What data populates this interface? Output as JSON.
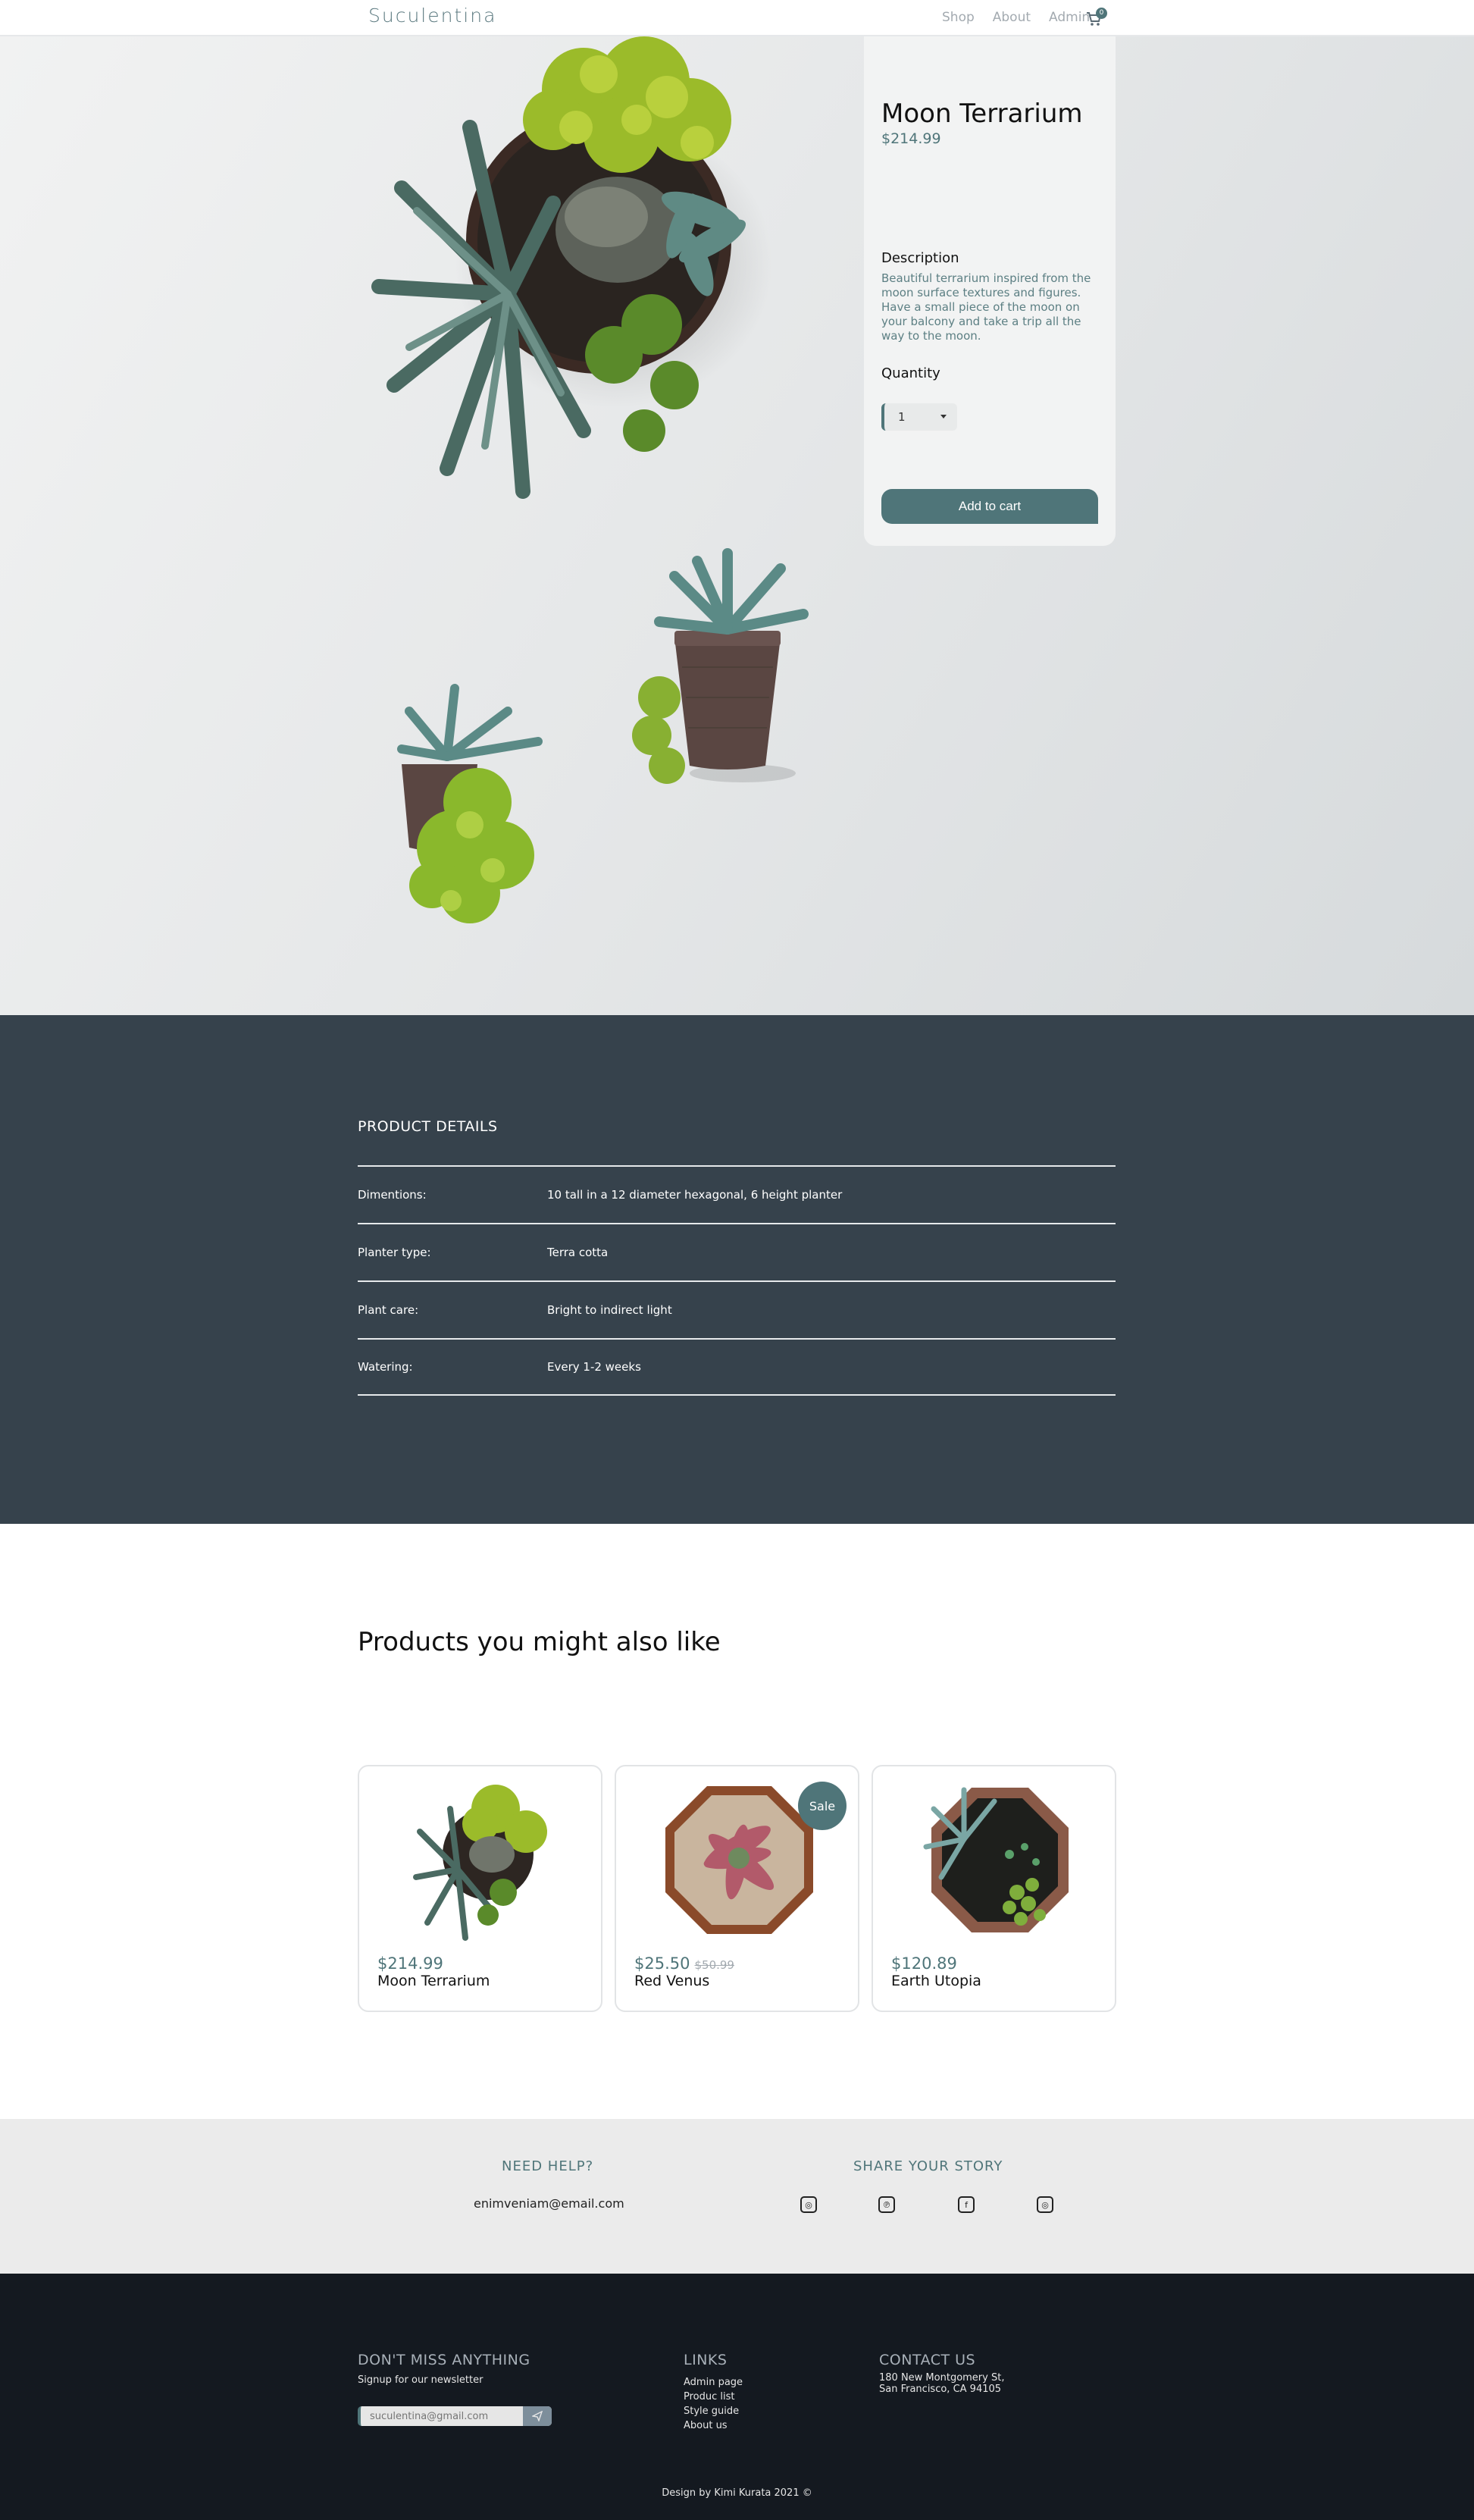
{
  "nav": {
    "logo": "Suculentina",
    "links": [
      "Shop",
      "About",
      "Admin"
    ],
    "cart_count": "0",
    "cart_icon": "cart-icon"
  },
  "product": {
    "title": "Moon Terrarium",
    "price": "$214.99",
    "description_heading": "Description",
    "description": "Beautiful terrarium inspired from the moon surface textures and figures. Have a small piece of the moon on your balcony and take a trip all the way to the moon.",
    "quantity_heading": "Quantity",
    "quantity_value": "1",
    "add_to_cart": "Add to cart"
  },
  "details": {
    "title": "PRODUCT DETAILS",
    "rows": [
      {
        "label": "Dimentions:",
        "value": "10 tall in a 12 diameter hexagonal, 6 height planter"
      },
      {
        "label": "Planter type:",
        "value": "Terra cotta"
      },
      {
        "label": "Plant care:",
        "value": "Bright to indirect light"
      },
      {
        "label": "Watering:",
        "value": "Every 1-2 weeks"
      }
    ]
  },
  "related": {
    "title": "Products you might also like",
    "cards": [
      {
        "price": "$214.99",
        "old_price": "",
        "name": "Moon Terrarium",
        "sale": ""
      },
      {
        "price": "$25.50",
        "old_price": "$50.99",
        "name": "Red Venus",
        "sale": "Sale"
      },
      {
        "price": "$120.89",
        "old_price": "",
        "name": "Earth Utopia",
        "sale": ""
      }
    ]
  },
  "help": {
    "need_help": "NEED HELP?",
    "email": "enimveniam@email.com",
    "share": "SHARE YOUR STORY",
    "social_icons": [
      "instagram-icon",
      "pinterest-icon",
      "facebook-icon",
      "instagram-icon"
    ]
  },
  "footer": {
    "newsletter_heading": "DON'T MISS ANYTHING",
    "newsletter_sub": "Signup for our newsletter",
    "newsletter_placeholder": "suculentina@gmail.com",
    "links_heading": "LINKS",
    "links": [
      "Admin page",
      "Produc list",
      "Style guide",
      "About us"
    ],
    "contact_heading": "CONTACT US",
    "address_line1": "180 New Montgomery St,",
    "address_line2": "San Francisco, CA 94105",
    "credit": "Design by Kimi Kurata 2021 ©"
  },
  "colors": {
    "accent": "#4f7579",
    "details_bg": "#36424c",
    "footer_bg": "#141920",
    "help_bg": "#ebebeb"
  }
}
